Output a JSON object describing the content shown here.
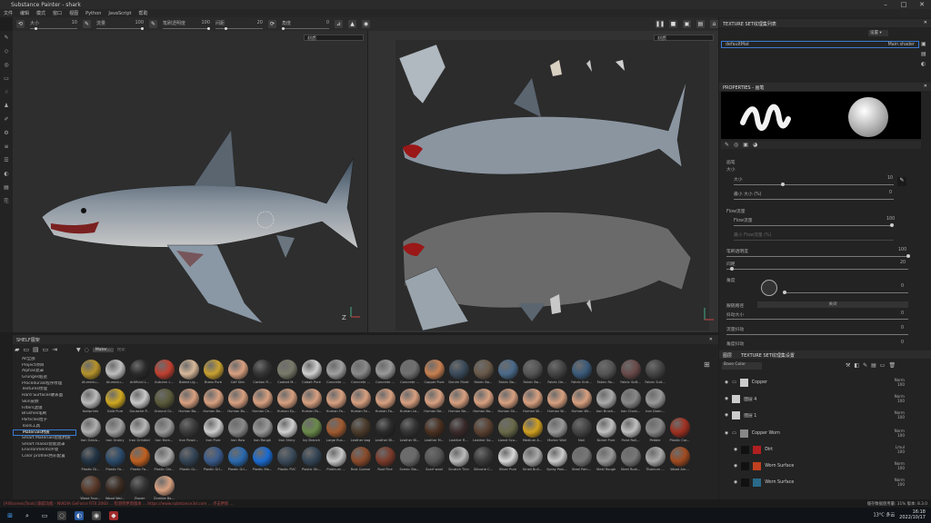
{
  "window": {
    "title": "Substance Painter - shark"
  },
  "menu": [
    "文件",
    "编辑",
    "模式",
    "窗口",
    "视图",
    "Python",
    "JavaScript",
    "帮助"
  ],
  "toolbar": {
    "size_label": "大小",
    "size_value": "10",
    "flow_label": "流量",
    "flow_value": "100",
    "opacity_label": "笔刷透明度",
    "opacity_value": "100",
    "spacing_label": "间距",
    "spacing_value": "20",
    "angle_label": "角度",
    "angle_value": "0"
  },
  "viewports": {
    "left_select": "材质",
    "right_select": "材质",
    "axis_label": "Z"
  },
  "texture_set_list": {
    "title": "TEXTURE SET纹理集列表",
    "setting": "设置 ▾",
    "item": "defaultMat",
    "shader": "Main shader"
  },
  "properties": {
    "title": "PROPERTIES - 画笔",
    "section": "画笔",
    "size_label": "大小",
    "size_sub": "大小",
    "size_value": "10",
    "min_size_label": "最小 大小 (%)",
    "min_size_value": "0",
    "flow_section": "Flow流量",
    "flow_label": "Flow流量",
    "flow_value": "100",
    "min_flow_label": "最小 Flow流量 (%)",
    "opacity_label": "笔刷透明度",
    "opacity_value": "100",
    "spacing_label": "间距",
    "spacing_value": "20",
    "angle_label": "角度",
    "angle_value": "0",
    "follow_label": "跟随路径",
    "follow_value": "关闭",
    "jitter_size_label": "抖动大小",
    "jitter_flow_label": "流量抖动",
    "jitter_angle_label": "角度抖动",
    "jitter_value": "0"
  },
  "layers_panel": {
    "tab1": "图层",
    "tab2": "TEXTURE SET纹理集设置",
    "channel": "Base Color",
    "layers": [
      {
        "name": "Copper",
        "blend": "Norm",
        "opacity": "100"
      },
      {
        "name": "图层 4",
        "blend": "Norm",
        "opacity": "100"
      },
      {
        "name": "图层 1",
        "blend": "Norm",
        "opacity": "100"
      },
      {
        "name": "Copper Worn",
        "blend": "Norm",
        "opacity": "100"
      },
      {
        "name": "Dirt",
        "blend": "Lmul",
        "opacity": "100"
      },
      {
        "name": "Worn Surface",
        "blend": "Norm",
        "opacity": "100"
      },
      {
        "name": "Worn Surface",
        "blend": "Norm",
        "opacity": "100"
      }
    ]
  },
  "shelf": {
    "title": "SHELF展架",
    "search_placeholder": "搜索",
    "filter_tag": "Mater...",
    "categories": [
      "All全部",
      "Project项目",
      "Alphas遮罩",
      "Grunges脏迹",
      "Procedurals程序纹理",
      "Textures纹理",
      "Hard Surfaces硬表面",
      "Skin皮肤",
      "Filters滤镜",
      "Brushes笔刷",
      "Particles粒子",
      "Tools工具",
      "Materials材质",
      "Smart Materials智能材质",
      "Smart masks智能遮罩",
      "Environments环境",
      "Color profiles色彩配置"
    ],
    "selected_category": "Materials材质",
    "materials": [
      {
        "name": "Aluminiu...",
        "color": "#b5922a"
      },
      {
        "name": "Aluminiu...",
        "color": "#bfbfbf"
      },
      {
        "name": "Artificial L...",
        "color": "#2a2a2a"
      },
      {
        "name": "Autumn L...",
        "color": "#c04030"
      },
      {
        "name": "Baked Lig...",
        "color": "#d8b89a"
      },
      {
        "name": "Brass Pure",
        "color": "#c8a030"
      },
      {
        "name": "Calf Skin",
        "color": "#d9a080"
      },
      {
        "name": "Carbon Fi...",
        "color": "#333333"
      },
      {
        "name": "Coated M...",
        "color": "#7a7a6a"
      },
      {
        "name": "Cobalt Pure",
        "color": "#d0d0d0"
      },
      {
        "name": "Concrete ...",
        "color": "#a0a0a0"
      },
      {
        "name": "Concrete ...",
        "color": "#8a8a8a"
      },
      {
        "name": "Concrete ...",
        "color": "#999999"
      },
      {
        "name": "Concrete ...",
        "color": "#707070"
      },
      {
        "name": "Copper Pure",
        "color": "#c88050"
      },
      {
        "name": "Denim Rivet",
        "color": "#3a4a5a"
      },
      {
        "name": "Fabric Ba...",
        "color": "#6a5a4a"
      },
      {
        "name": "Fabric Ba...",
        "color": "#4a6a8a"
      },
      {
        "name": "Fabric Ba...",
        "color": "#555555"
      },
      {
        "name": "Fabric De...",
        "color": "#444444"
      },
      {
        "name": "Fabric Knit...",
        "color": "#3a5a7a"
      },
      {
        "name": "Fabric Ro...",
        "color": "#555555"
      },
      {
        "name": "Fabric Soft...",
        "color": "#6a4a4a"
      },
      {
        "name": "Fabric Suit...",
        "color": "#444444"
      },
      {
        "name": "footprints",
        "color": "#bbbbbb"
      },
      {
        "name": "Gold Pure",
        "color": "#d0a820"
      },
      {
        "name": "Gouache P...",
        "color": "#c8c8c8"
      },
      {
        "name": "Ground Gr...",
        "color": "#5a5a3a"
      },
      {
        "name": "Human Ba...",
        "color": "#d8a080"
      },
      {
        "name": "Human Be...",
        "color": "#d8a080"
      },
      {
        "name": "Human Bu...",
        "color": "#d8a080"
      },
      {
        "name": "Human Ch...",
        "color": "#d8a080"
      },
      {
        "name": "Human Ey...",
        "color": "#d8a080"
      },
      {
        "name": "Human Fa...",
        "color": "#d8a080"
      },
      {
        "name": "Human Fa...",
        "color": "#d8a080"
      },
      {
        "name": "Human Fe...",
        "color": "#d8a080"
      },
      {
        "name": "Human Fo...",
        "color": "#d8a080"
      },
      {
        "name": "Human Le...",
        "color": "#d8a080"
      },
      {
        "name": "Human Ne...",
        "color": "#d8a080"
      },
      {
        "name": "Human Ne...",
        "color": "#d8a080"
      },
      {
        "name": "Human No...",
        "color": "#d8a080"
      },
      {
        "name": "Human Sh...",
        "color": "#d8a080"
      },
      {
        "name": "Human W...",
        "color": "#d8a080"
      },
      {
        "name": "Human W...",
        "color": "#d8a080"
      },
      {
        "name": "Human Wr...",
        "color": "#d8a080"
      },
      {
        "name": "Iron Brush...",
        "color": "#aaaaaa"
      },
      {
        "name": "Iron Chain...",
        "color": "#888888"
      },
      {
        "name": "Iron Diam...",
        "color": "#999999"
      },
      {
        "name": "Iron Galva...",
        "color": "#b0b0b0"
      },
      {
        "name": "Iron Grainy",
        "color": "#a0a0a0"
      },
      {
        "name": "Iron Grinded",
        "color": "#b8b8b8"
      },
      {
        "name": "Iron Ham...",
        "color": "#9a9a9a"
      },
      {
        "name": "Iron Powd...",
        "color": "#3a3a3a"
      },
      {
        "name": "Iron Pure",
        "color": "#cccccc"
      },
      {
        "name": "Iron Raw",
        "color": "#8a8a8a"
      },
      {
        "name": "Iron Rough",
        "color": "#999999"
      },
      {
        "name": "Iron Shiny",
        "color": "#d0d0d0"
      },
      {
        "name": "Ivy Branch",
        "color": "#6a8a4a"
      },
      {
        "name": "Large Rus...",
        "color": "#a05a30"
      },
      {
        "name": "Leather bag",
        "color": "#4a3a2a"
      },
      {
        "name": "Leather Bl...",
        "color": "#2a2a2a"
      },
      {
        "name": "Leather Bl...",
        "color": "#333333"
      },
      {
        "name": "Leather M...",
        "color": "#4a3020"
      },
      {
        "name": "Leather R...",
        "color": "#3a2a2a"
      },
      {
        "name": "Leather Sa...",
        "color": "#5a4030"
      },
      {
        "name": "Lizard Sca...",
        "color": "#6a6a4a"
      },
      {
        "name": "Medium A...",
        "color": "#d0a020"
      },
      {
        "name": "Mortar Wall",
        "color": "#999999"
      },
      {
        "name": "Nail",
        "color": "#444444"
      },
      {
        "name": "Nickel Pure",
        "color": "#c0c0c0"
      },
      {
        "name": "Paint Roll...",
        "color": "#c0c0c0"
      },
      {
        "name": "Pebble",
        "color": "#888888"
      },
      {
        "name": "Plastic Car...",
        "color": "#a03020"
      },
      {
        "name": "Plastic Di...",
        "color": "#223344"
      },
      {
        "name": "Plastic Fa...",
        "color": "#2a4a6a"
      },
      {
        "name": "Plastic Fa...",
        "color": "#c06020"
      },
      {
        "name": "Plastic Glo...",
        "color": "#aaaaaa"
      },
      {
        "name": "Plastic Gr...",
        "color": "#334455"
      },
      {
        "name": "Plastic Gri...",
        "color": "#3a5a8a"
      },
      {
        "name": "Plastic Gri...",
        "color": "#2a6ab0"
      },
      {
        "name": "Plastic Ma...",
        "color": "#1a6ad0"
      },
      {
        "name": "Plastic PVC",
        "color": "#3a4a5a"
      },
      {
        "name": "Plastic Str...",
        "color": "#334455"
      },
      {
        "name": "Platinum ...",
        "color": "#c8c8c8"
      },
      {
        "name": "Rust Coarse",
        "color": "#8a4a2a"
      },
      {
        "name": "Rust Fine",
        "color": "#7a3a2a"
      },
      {
        "name": "Scenic Blo...",
        "color": "#6a6a6a"
      },
      {
        "name": "Scarf wool",
        "color": "#555555"
      },
      {
        "name": "Scratch Thin",
        "color": "#bbbbbb"
      },
      {
        "name": "Silicone C...",
        "color": "#3a3a3a"
      },
      {
        "name": "Silver Pure",
        "color": "#d8d8d8"
      },
      {
        "name": "Small Bull...",
        "color": "#aaaaaa"
      },
      {
        "name": "Spray Pain...",
        "color": "#cccccc"
      },
      {
        "name": "Steel Pain...",
        "color": "#777777"
      },
      {
        "name": "Steel Rough",
        "color": "#999999"
      },
      {
        "name": "Steel Rust...",
        "color": "#777777"
      },
      {
        "name": "Titanium ...",
        "color": "#aaaaaa"
      },
      {
        "name": "Wood Am...",
        "color": "#a04a20"
      },
      {
        "name": "Wood Four...",
        "color": "#5a3a2a"
      },
      {
        "name": "Wood Wal...",
        "color": "#3a2a20"
      },
      {
        "name": "Zipper",
        "color": "#333333"
      },
      {
        "name": "Zombie Ba...",
        "color": "#d8a080"
      }
    ]
  },
  "status": {
    "message": "[AllScenes|Tools] 跟踪功能 - NVIDIA GeForce RTX 2060 ... 检测到更新版本 ... https://www.substance3d.com ... 点击更新 ...",
    "gpu_label": "缓存数据使用量:",
    "gpu_value": "31%",
    "version": "版本: 8.3.0"
  },
  "taskbar": {
    "weather": "13°C 多云",
    "time": "16:18",
    "date": "2022/10/17"
  }
}
